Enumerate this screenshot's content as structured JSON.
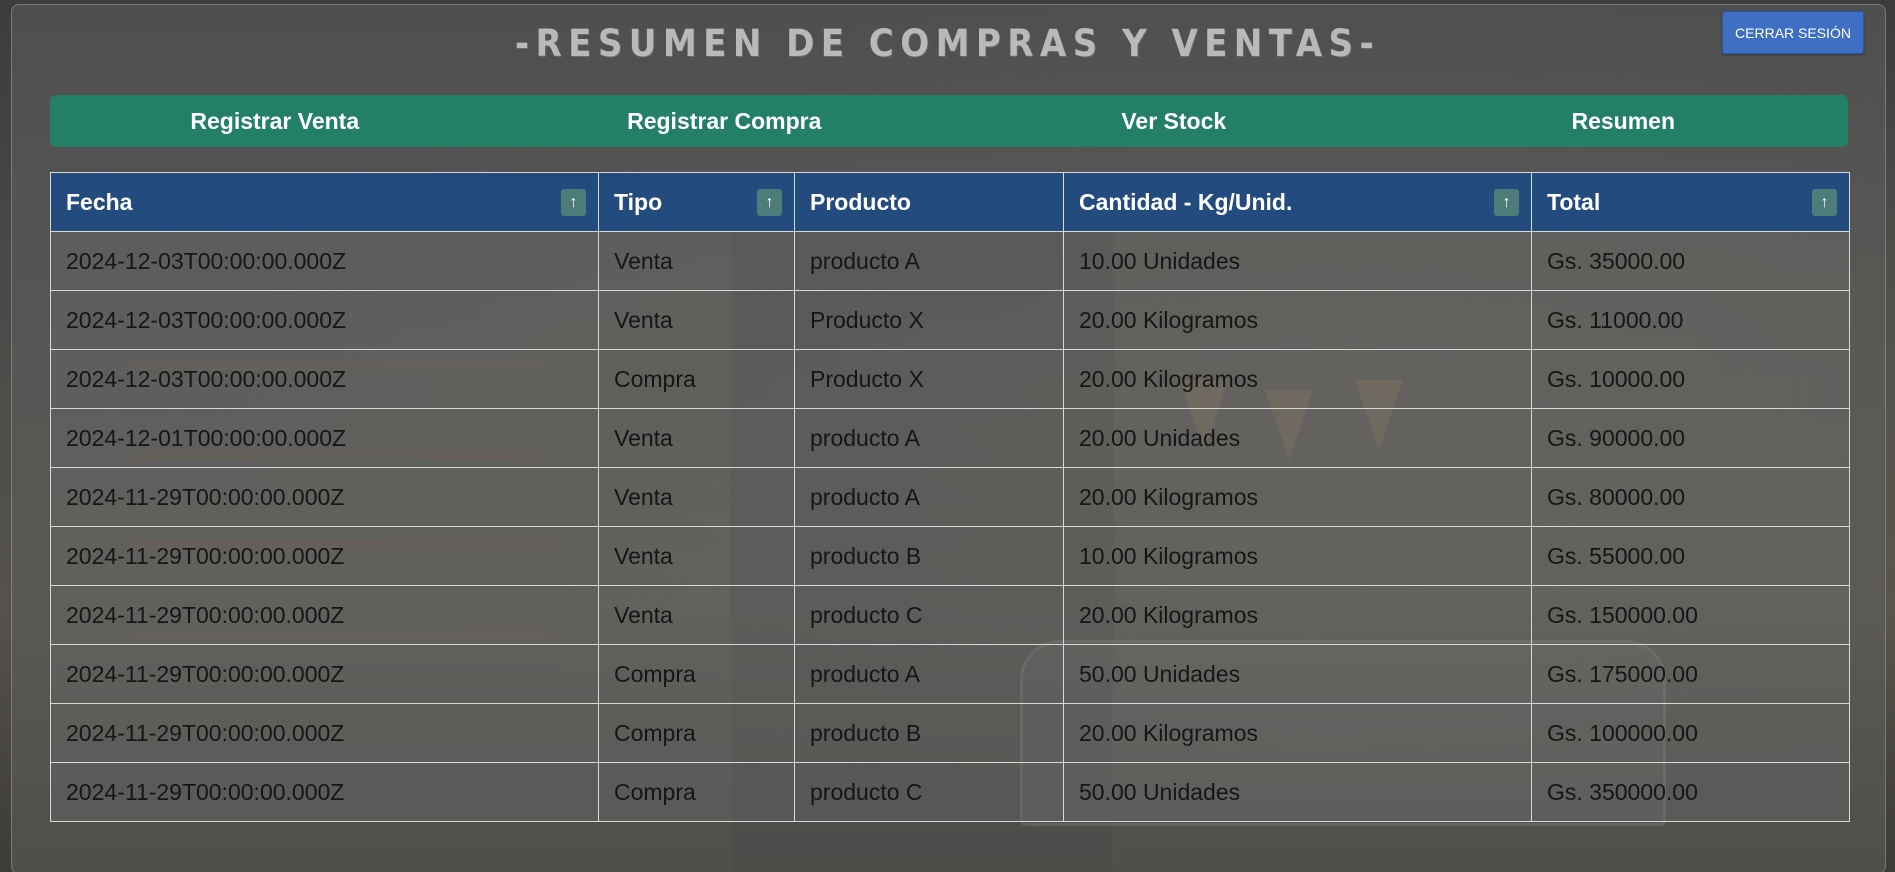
{
  "header": {
    "title": "-RESUMEN DE COMPRAS Y VENTAS-",
    "logout_label": "CERRAR SESIÓN"
  },
  "nav": {
    "items": [
      "Registrar Venta",
      "Registrar Compra",
      "Ver Stock",
      "Resumen"
    ]
  },
  "table": {
    "columns": [
      {
        "label": "Fecha",
        "sortable": true
      },
      {
        "label": "Tipo",
        "sortable": true
      },
      {
        "label": "Producto",
        "sortable": false
      },
      {
        "label": "Cantidad - Kg/Unid.",
        "sortable": true
      },
      {
        "label": "Total",
        "sortable": true
      }
    ],
    "sort_icon": "↑",
    "rows": [
      [
        "2024-12-03T00:00:00.000Z",
        "Venta",
        "producto A",
        "10.00 Unidades",
        "Gs. 35000.00"
      ],
      [
        "2024-12-03T00:00:00.000Z",
        "Venta",
        "Producto X",
        "20.00 Kilogramos",
        "Gs. 11000.00"
      ],
      [
        "2024-12-03T00:00:00.000Z",
        "Compra",
        "Producto X",
        "20.00 Kilogramos",
        "Gs. 10000.00"
      ],
      [
        "2024-12-01T00:00:00.000Z",
        "Venta",
        "producto A",
        "20.00 Unidades",
        "Gs. 90000.00"
      ],
      [
        "2024-11-29T00:00:00.000Z",
        "Venta",
        "producto A",
        "20.00 Kilogramos",
        "Gs. 80000.00"
      ],
      [
        "2024-11-29T00:00:00.000Z",
        "Venta",
        "producto B",
        "10.00 Kilogramos",
        "Gs. 55000.00"
      ],
      [
        "2024-11-29T00:00:00.000Z",
        "Venta",
        "producto C",
        "20.00 Kilogramos",
        "Gs. 150000.00"
      ],
      [
        "2024-11-29T00:00:00.000Z",
        "Compra",
        "producto A",
        "50.00 Unidades",
        "Gs. 175000.00"
      ],
      [
        "2024-11-29T00:00:00.000Z",
        "Compra",
        "producto B",
        "20.00 Kilogramos",
        "Gs. 100000.00"
      ],
      [
        "2024-11-29T00:00:00.000Z",
        "Compra",
        "producto C",
        "50.00 Unidades",
        "Gs. 350000.00"
      ]
    ]
  },
  "colors": {
    "nav_bg": "#237f65",
    "table_header_bg": "#234b7d",
    "logout_bg": "#3f6fc2",
    "sort_button_bg": "#4e7c78"
  }
}
